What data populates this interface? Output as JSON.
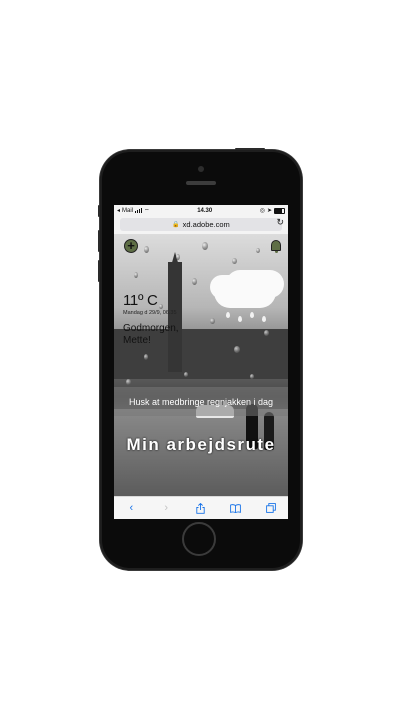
{
  "status_bar": {
    "carrier": "Mail",
    "time": "14.30"
  },
  "browser": {
    "url": "xd.adobe.com"
  },
  "weather": {
    "temperature": "11º C",
    "date": "Mandag d 29/9, 06.35",
    "greeting": "Godmorgen, Mette!",
    "reminder": "Husk at medbringe regnjakken i dag"
  },
  "route_button_label": "Min arbejdsrute",
  "colors": {
    "accent": "#5e6e45",
    "link_blue": "#1a74e8"
  }
}
